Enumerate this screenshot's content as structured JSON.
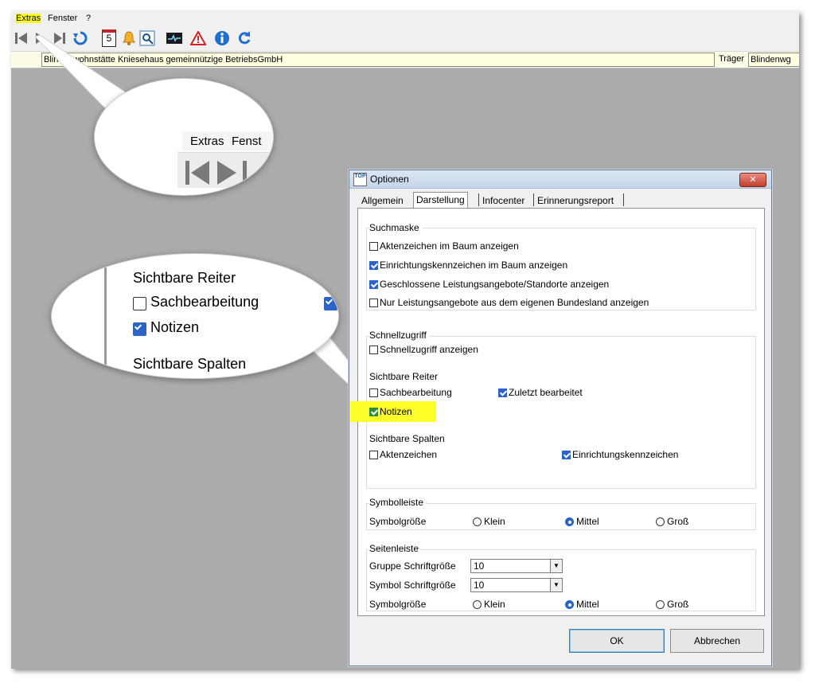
{
  "menu": {
    "extras": "Extras",
    "fenster": "Fenster",
    "help": "?"
  },
  "toolbar": {
    "calendar_day": "5"
  },
  "infobar": {
    "organisation": "Blindenwohnstätte Kniesehaus gemeinnützige BetriebsGmbH",
    "traeger_label": "Träger",
    "traeger_value": "Blindenwg"
  },
  "zoom_top": {
    "extras": "Extras",
    "fenster": "Fenst"
  },
  "zoom_mid": {
    "reiter_title": "Sichtbare Reiter",
    "sachbearbeitung": "Sachbearbeitung",
    "notizen": "Notizen",
    "spalten_title": "Sichtbare Spalten"
  },
  "dialog": {
    "app_icon": "TOP",
    "title": "Optionen",
    "close": "✕",
    "tabs": [
      "Allgemein",
      "Darstellung",
      "Infocenter",
      "Erinnerungsreport"
    ],
    "active_tab": "Darstellung",
    "suchmaske": {
      "title": "Suchmaske",
      "items": [
        {
          "label": "Aktenzeichen im Baum anzeigen",
          "checked": false
        },
        {
          "label": "Einrichtungskennzeichen im Baum anzeigen",
          "checked": true
        },
        {
          "label": "Geschlossene Leistungsangebote/Standorte anzeigen",
          "checked": true
        },
        {
          "label": "Nur Leistungsangebote aus dem eigenen Bundesland anzeigen",
          "checked": false
        }
      ]
    },
    "schnellzugriff": {
      "title": "Schnellzugriff",
      "show": {
        "label": "Schnellzugriff anzeigen",
        "checked": false
      },
      "reiter_title": "Sichtbare Reiter",
      "sachbearbeitung": {
        "label": "Sachbearbeitung",
        "checked": false
      },
      "zuletzt": {
        "label": "Zuletzt bearbeitet",
        "checked": true
      },
      "notizen": {
        "label": "Notizen",
        "checked": true
      },
      "spalten_title": "Sichtbare Spalten",
      "aktenzeichen": {
        "label": "Aktenzeichen",
        "checked": false
      },
      "einrichtung": {
        "label": "Einrichtungskennzeichen",
        "checked": true
      }
    },
    "symbolleiste": {
      "title": "Symbolleiste",
      "size_label": "Symbolgröße",
      "options": [
        "Klein",
        "Mittel",
        "Groß"
      ],
      "selected": "Mittel"
    },
    "seitenleiste": {
      "title": "Seitenleiste",
      "gruppe_label": "Gruppe Schriftgröße",
      "gruppe_value": "10",
      "symbol_label": "Symbol Schriftgröße",
      "symbol_value": "10",
      "size_label": "Symbolgröße",
      "options": [
        "Klein",
        "Mittel",
        "Groß"
      ],
      "selected": "Mittel"
    },
    "buttons": {
      "ok": "OK",
      "cancel": "Abbrechen"
    }
  },
  "colors": {
    "highlight": "#ffff29",
    "accent": "#2b63c7",
    "workspace": "#ababab"
  }
}
